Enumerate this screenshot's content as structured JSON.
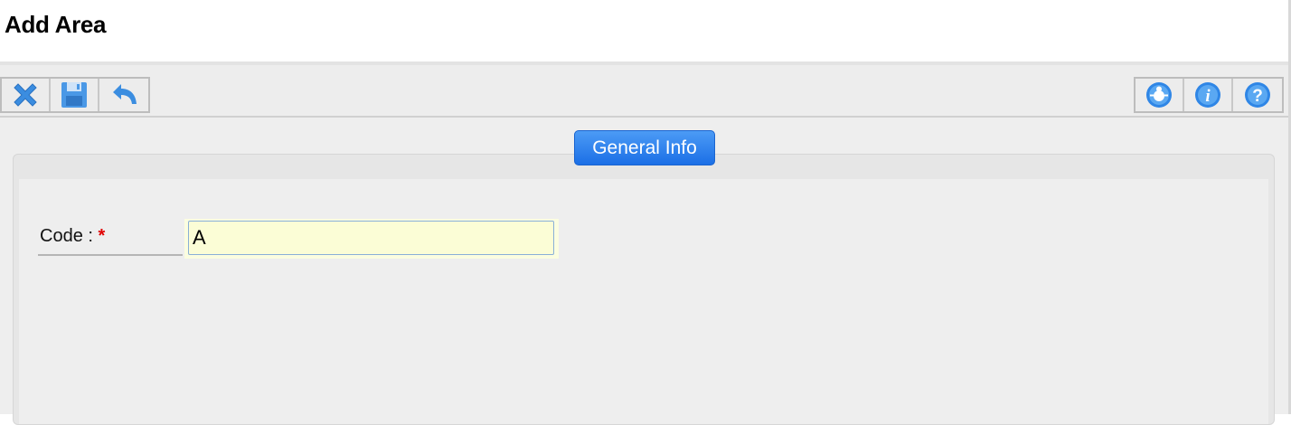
{
  "page": {
    "title": "Add Area"
  },
  "toolbar": {
    "left_buttons": [
      {
        "icon": "close-icon"
      },
      {
        "icon": "save-icon"
      },
      {
        "icon": "undo-icon"
      }
    ],
    "right_buttons": [
      {
        "icon": "bug-icon"
      },
      {
        "icon": "info-icon"
      },
      {
        "icon": "help-icon"
      }
    ]
  },
  "tabs": {
    "general_info": "General Info"
  },
  "form": {
    "code_label": "Code :",
    "required_marker": "*",
    "code_value": "A"
  },
  "colors": {
    "tab_active": "#1b6fe6",
    "icon_blue": "#3b8de0",
    "required": "#e00000",
    "input_bg": "#fbfdd6"
  }
}
